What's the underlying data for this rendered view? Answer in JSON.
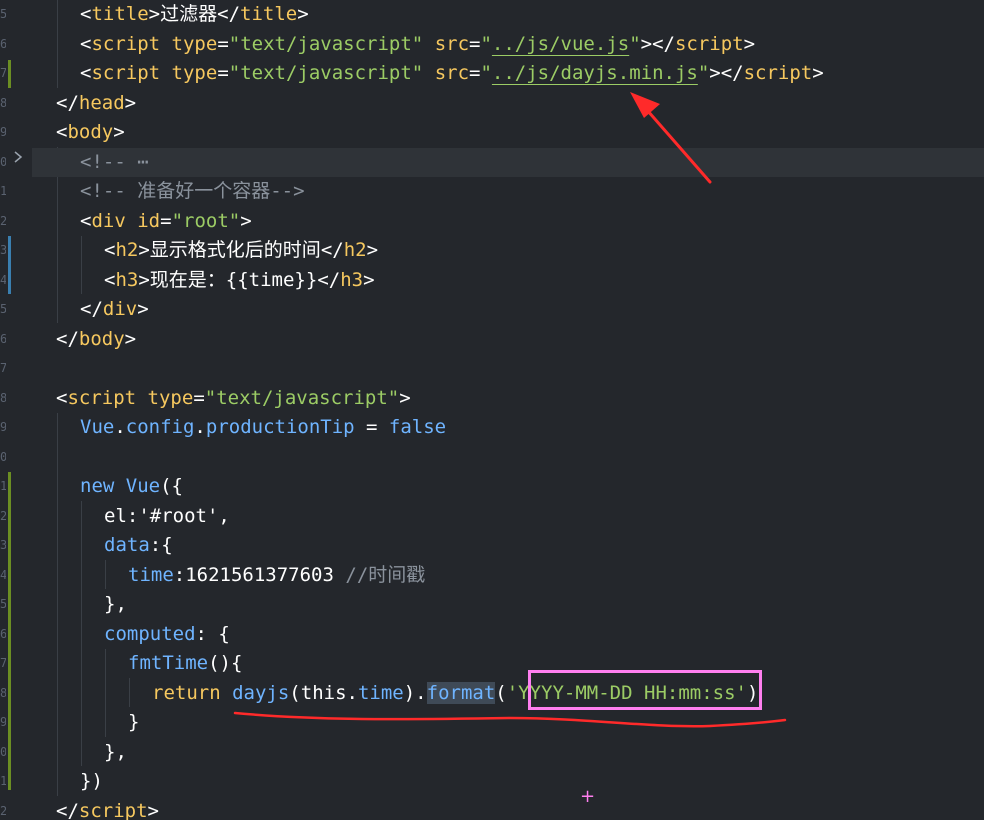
{
  "editor": {
    "lines": {
      "l1": {
        "t1": "<",
        "tag": "title",
        "t2": ">",
        "text": "过滤器",
        "t3": "</",
        "tag2": "title",
        "t4": ">"
      },
      "l2": {
        "o": "<",
        "tag": "script",
        "a1": "type",
        "eq1": "=",
        "v1": "\"text/javascript\"",
        "a2": "src",
        "eq2": "=",
        "q1": "\"",
        "v2": "../js/vue.js",
        "q2": "\"",
        "c": "></",
        "tag2": "script",
        "e": ">"
      },
      "l3": {
        "o": "<",
        "tag": "script",
        "a1": "type",
        "eq1": "=",
        "v1": "\"text/javascript\"",
        "a2": "src",
        "eq2": "=",
        "q1": "\"",
        "v2": "../js/dayjs.min.js",
        "q2": "\"",
        "c": "></",
        "tag2": "script",
        "e": ">"
      },
      "l4": {
        "o": "</",
        "tag": "head",
        "e": ">"
      },
      "l5": {
        "o": "<",
        "tag": "body",
        "e": ">"
      },
      "l6": {
        "text": "<!-- ⋯"
      },
      "l7": {
        "text": "<!-- 准备好一个容器-->"
      },
      "l8": {
        "o": "<",
        "tag": "div",
        "a1": "id",
        "eq": "=",
        "v1": "\"root\"",
        "e": ">"
      },
      "l9": {
        "o": "<",
        "tag": "h2",
        "e": ">",
        "text": "显示格式化后的时间",
        "c": "</",
        "tag2": "h2",
        "e2": ">"
      },
      "l10": {
        "o": "<",
        "tag": "h3",
        "e": ">",
        "text": "现在是：{{time}}",
        "c": "</",
        "tag2": "h3",
        "e2": ">"
      },
      "l11": {
        "o": "</",
        "tag": "div",
        "e": ">"
      },
      "l12": {
        "o": "</",
        "tag": "body",
        "e": ">"
      },
      "l14": {
        "o": "<",
        "tag": "script",
        "a1": "type",
        "eq": "=",
        "v1": "\"text/javascript\"",
        "e": ">"
      },
      "l15": {
        "a": "Vue",
        "dot1": ".",
        "b": "config",
        "dot2": ".",
        "c": "productionTip",
        "eq": " = ",
        "d": "false"
      },
      "l17": {
        "kw": "new",
        "cls": "Vue",
        "p": "({"
      },
      "l18": {
        "k": "el",
        "colon": ":",
        "v": "'#root'",
        "comma": ","
      },
      "l19": {
        "k": "data",
        "p": ":{"
      },
      "l20": {
        "k": "time",
        "colon": ":",
        "num": "1621561377603",
        "cmt": "//时间戳"
      },
      "l21": {
        "p": "},"
      },
      "l22": {
        "k": "computed",
        "p": ": {"
      },
      "l23": {
        "fn": "fmtTime",
        "p": "(){"
      },
      "l24": {
        "kw": "return",
        "fn": "dayjs",
        "p1": "(",
        "this": "this",
        "dot": ".",
        "prop": "time",
        "p2": ").",
        "m": "format",
        "p3": "(",
        "q1": "'",
        "s": "YYYY-MM-DD HH:mm:ss",
        "q2": "'",
        "p4": ")"
      },
      "l25": {
        "p": "}"
      },
      "l26": {
        "p": "},"
      },
      "l27": {
        "p": "})"
      },
      "l28": {
        "o": "</",
        "tag": "script",
        "e": ">"
      }
    },
    "gutter_numbers": [
      "5",
      "6",
      "7",
      "8",
      "9",
      "0",
      "1",
      "2",
      "3",
      "4",
      "5",
      "6",
      "7",
      "8",
      "9",
      "0",
      "1",
      "2",
      "3",
      "4",
      "5",
      "6",
      "7",
      "8",
      "9",
      "0",
      "1",
      "2"
    ],
    "fold_icon": "chevron-right-icon"
  },
  "colors": {
    "background": "#24272c",
    "tag": "#f6c85f",
    "string": "#9ccc65",
    "keyword_blue": "#6fb4ff",
    "annotation_red": "#ff2a2a",
    "annotation_pink": "#ff7ff0"
  },
  "annotations": {
    "cursor_glyph": "+"
  }
}
